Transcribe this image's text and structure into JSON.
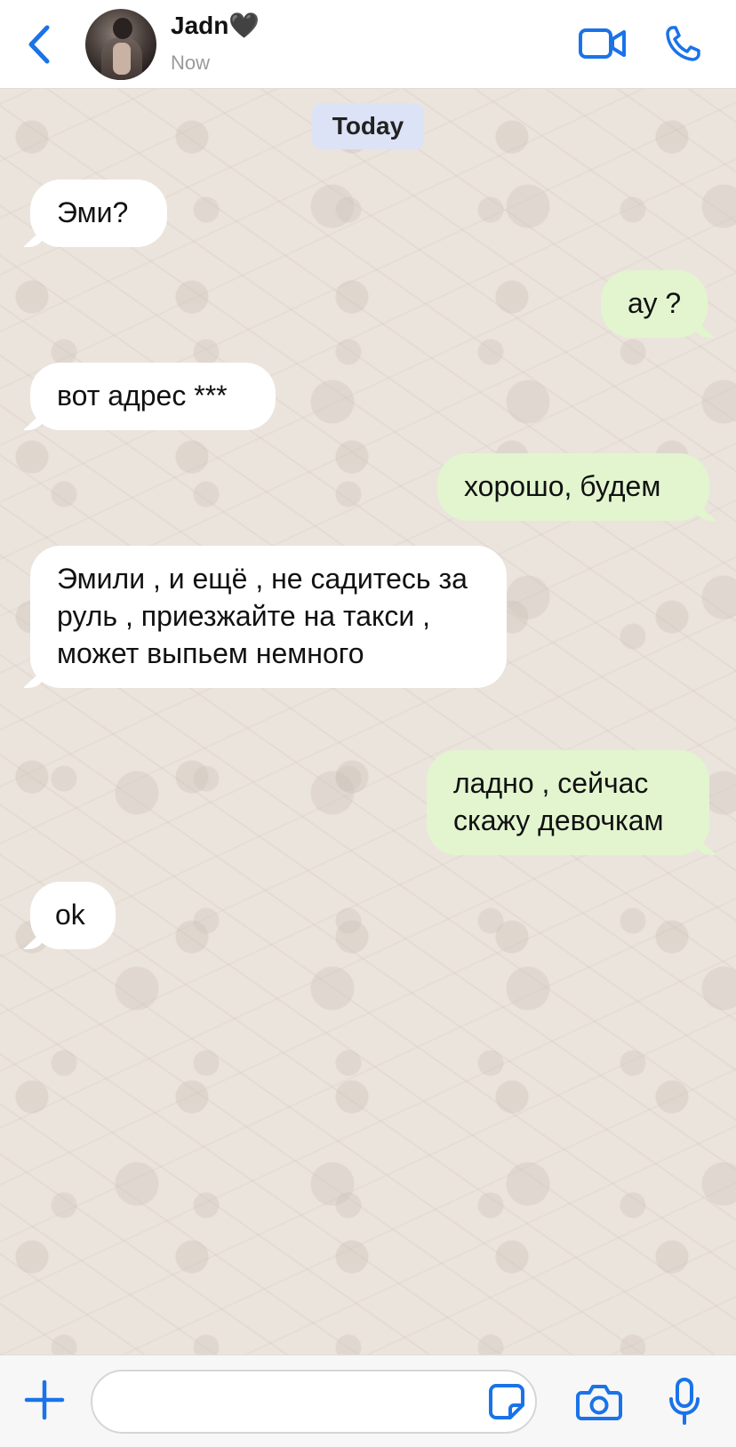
{
  "header": {
    "contact_name": "Jadn🖤",
    "status": "Now"
  },
  "chat": {
    "date_label": "Today",
    "messages": [
      {
        "direction": "in",
        "text": "Эми?"
      },
      {
        "direction": "out",
        "text": "ау ?"
      },
      {
        "direction": "in",
        "text": "вот адрес ***"
      },
      {
        "direction": "out",
        "text": "хорошо, будем"
      },
      {
        "direction": "in",
        "text": "Эмили , и ещё , не садитесь за руль , приезжайте на такси , может выпьем немного"
      },
      {
        "direction": "out",
        "text": "ладно , сейчас скажу девочкам"
      },
      {
        "direction": "in",
        "text": "ok"
      }
    ]
  },
  "composer": {
    "input_value": "",
    "placeholder": ""
  },
  "colors": {
    "accent": "#1a73e8",
    "incoming_bubble": "#ffffff",
    "outgoing_bubble": "#e2f5cf",
    "chat_background": "#ebe4dc",
    "date_pill": "#dde3f6"
  },
  "icons": {
    "back": "chevron-left-icon",
    "video": "video-camera-icon",
    "call": "phone-icon",
    "add": "plus-icon",
    "sticker": "sticker-icon",
    "camera": "camera-icon",
    "mic": "microphone-icon"
  }
}
